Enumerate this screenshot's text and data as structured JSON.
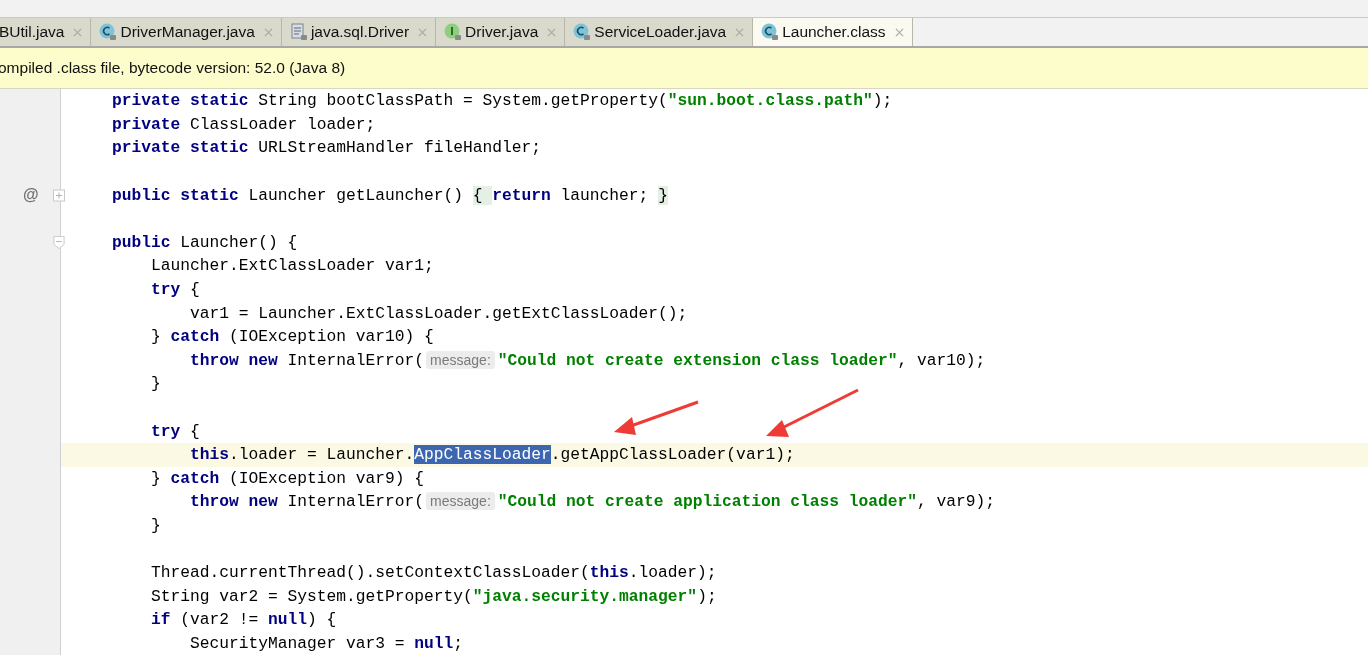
{
  "tabs": [
    {
      "label": "BUtil.java",
      "kind": "plain",
      "selected": false
    },
    {
      "label": "DriverManager.java",
      "kind": "class",
      "selected": false
    },
    {
      "label": "java.sql.Driver",
      "kind": "file",
      "selected": false
    },
    {
      "label": "Driver.java",
      "kind": "interface",
      "selected": false
    },
    {
      "label": "ServiceLoader.java",
      "kind": "class",
      "selected": false
    },
    {
      "label": "Launcher.class",
      "kind": "class",
      "selected": true
    }
  ],
  "info_bar": {
    "text": "ompiled .class file, bytecode version: 52.0 (Java 8)"
  },
  "lines": [
    {
      "current": false,
      "tokens": [
        {
          "kind": "keyword",
          "text": "    private static "
        },
        {
          "kind": "plain",
          "text": "String bootClassPath = System.getProperty("
        },
        {
          "kind": "string",
          "text": "\"sun.boot.class.path\""
        },
        {
          "kind": "plain",
          "text": ");"
        }
      ]
    },
    {
      "current": false,
      "tokens": [
        {
          "kind": "keyword",
          "text": "    private"
        },
        {
          "kind": "plain",
          "text": " ClassLoader loader;"
        }
      ]
    },
    {
      "current": false,
      "tokens": [
        {
          "kind": "keyword",
          "text": "    private static "
        },
        {
          "kind": "plain",
          "text": "URLStreamHandler fileHandler;"
        }
      ]
    },
    {
      "current": false
    },
    {
      "current": false,
      "gutter_mark": "@",
      "fold": {
        "collapsed": true
      },
      "tokens": [
        {
          "kind": "keyword",
          "text": "    public static "
        },
        {
          "kind": "plain",
          "text": "Launcher getLauncher() "
        },
        {
          "kind": "folded",
          "text": "{ "
        },
        {
          "kind": "keyword",
          "text": "return"
        },
        {
          "kind": "plain",
          "text": " launcher; "
        },
        {
          "kind": "folded",
          "text": "}"
        }
      ]
    },
    {
      "current": false
    },
    {
      "current": false,
      "fold": {
        "collapsed": false
      },
      "tokens": [
        {
          "kind": "keyword",
          "text": "    public"
        },
        {
          "kind": "plain",
          "text": " Launcher() {"
        }
      ]
    },
    {
      "current": false,
      "tokens": [
        {
          "kind": "plain",
          "text": "        Launcher.ExtClassLoader var1;"
        }
      ]
    },
    {
      "current": false,
      "tokens": [
        {
          "kind": "keyword",
          "text": "        try"
        },
        {
          "kind": "plain",
          "text": " {"
        }
      ]
    },
    {
      "current": false,
      "tokens": [
        {
          "kind": "plain",
          "text": "            var1 = Launcher.ExtClassLoader.getExtClassLoader();"
        }
      ]
    },
    {
      "current": false,
      "tokens": [
        {
          "kind": "plain",
          "text": "        } "
        },
        {
          "kind": "keyword",
          "text": "catch"
        },
        {
          "kind": "plain",
          "text": " (IOException var10) {"
        }
      ]
    },
    {
      "current": false,
      "tokens": [
        {
          "kind": "keyword",
          "text": "            throw new"
        },
        {
          "kind": "plain",
          "text": " InternalError("
        },
        {
          "kind": "hint",
          "text": "message:"
        },
        {
          "kind": "string",
          "text": "\"Could not create extension class loader\""
        },
        {
          "kind": "plain",
          "text": ", var10);"
        }
      ]
    },
    {
      "current": false,
      "tokens": [
        {
          "kind": "plain",
          "text": "        }"
        }
      ]
    },
    {
      "current": false
    },
    {
      "current": false,
      "tokens": [
        {
          "kind": "keyword",
          "text": "        try"
        },
        {
          "kind": "plain",
          "text": " {"
        }
      ]
    },
    {
      "current": true,
      "tokens": [
        {
          "kind": "keyword",
          "text": "            this"
        },
        {
          "kind": "plain",
          "text": ".loader = Launcher."
        },
        {
          "kind": "selection",
          "text": "AppClassLoader"
        },
        {
          "kind": "plain",
          "text": ".getAppClassLoader(var1);"
        }
      ]
    },
    {
      "current": false,
      "tokens": [
        {
          "kind": "plain",
          "text": "        } "
        },
        {
          "kind": "keyword",
          "text": "catch"
        },
        {
          "kind": "plain",
          "text": " (IOException var9) {"
        }
      ]
    },
    {
      "current": false,
      "tokens": [
        {
          "kind": "keyword",
          "text": "            throw new"
        },
        {
          "kind": "plain",
          "text": " InternalError("
        },
        {
          "kind": "hint",
          "text": "message:"
        },
        {
          "kind": "string",
          "text": "\"Could not create application class loader\""
        },
        {
          "kind": "plain",
          "text": ", var9);"
        }
      ]
    },
    {
      "current": false,
      "tokens": [
        {
          "kind": "plain",
          "text": "        }"
        }
      ]
    },
    {
      "current": false
    },
    {
      "current": false,
      "tokens": [
        {
          "kind": "plain",
          "text": "        Thread.currentThread().setContextClassLoader("
        },
        {
          "kind": "keyword",
          "text": "this"
        },
        {
          "kind": "plain",
          "text": ".loader);"
        }
      ]
    },
    {
      "current": false,
      "tokens": [
        {
          "kind": "plain",
          "text": "        String var2 = System.getProperty("
        },
        {
          "kind": "string",
          "text": "\"java.security.manager\""
        },
        {
          "kind": "plain",
          "text": ");"
        }
      ]
    },
    {
      "current": false,
      "tokens": [
        {
          "kind": "keyword",
          "text": "        if"
        },
        {
          "kind": "plain",
          "text": " (var2 != "
        },
        {
          "kind": "keyword",
          "text": "null"
        },
        {
          "kind": "plain",
          "text": ") {"
        }
      ]
    },
    {
      "current": false,
      "tokens": [
        {
          "kind": "plain",
          "text": "            SecurityManager var3 = "
        },
        {
          "kind": "keyword",
          "text": "null"
        },
        {
          "kind": "plain",
          "text": ";"
        }
      ]
    }
  ]
}
